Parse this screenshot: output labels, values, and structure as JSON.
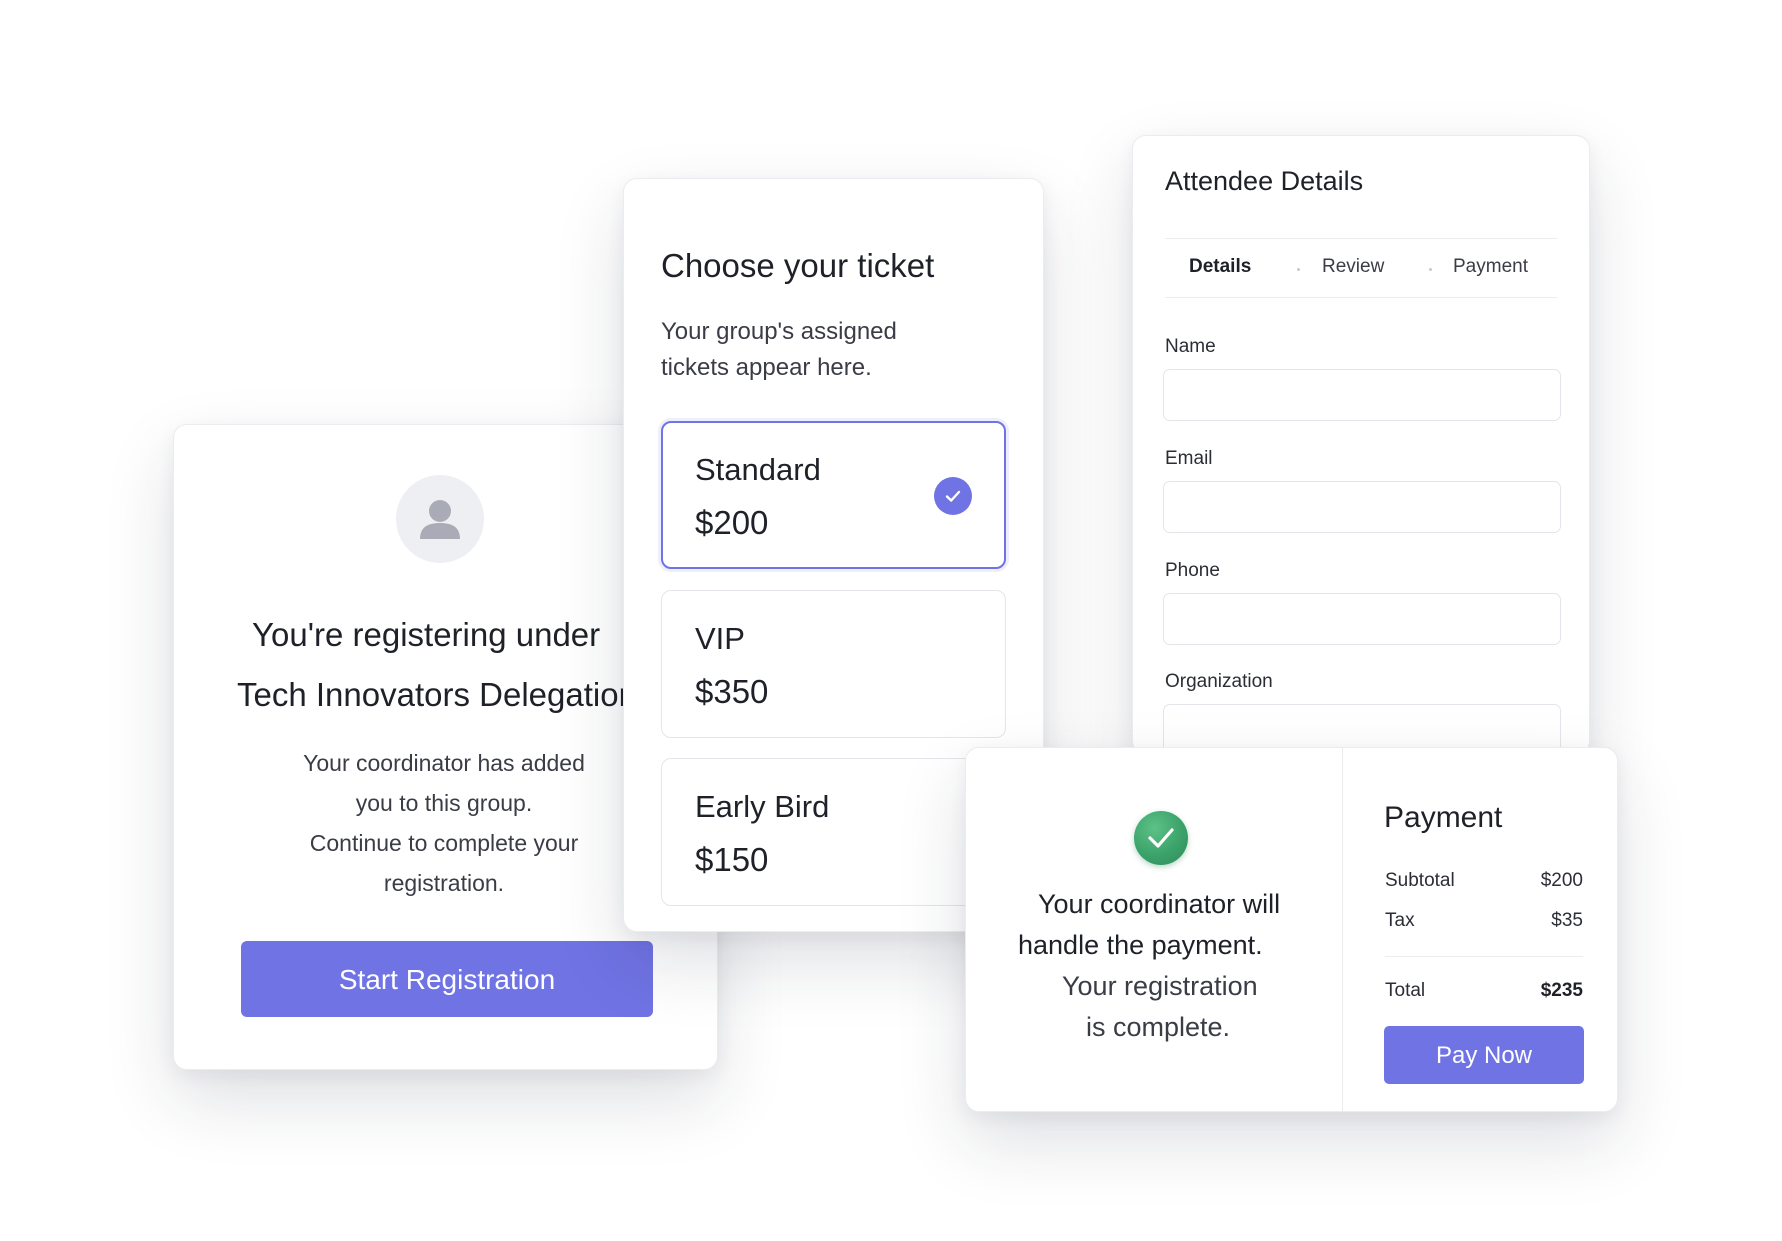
{
  "group_card": {
    "heading_line1": "You're registering under",
    "heading_line2": "Tech Innovators Delegation",
    "body_lines": [
      "Your coordinator has added",
      "you to this group.",
      "Continue to complete your",
      "registration."
    ],
    "start_button": "Start Registration",
    "icons": {
      "avatar": "user-avatar-icon"
    }
  },
  "ticket_card": {
    "title": "Choose your ticket",
    "subtitle_lines": [
      "Your group's assigned",
      "tickets appear here."
    ],
    "tickets": [
      {
        "name": "Standard",
        "price": "$200",
        "selected": true
      },
      {
        "name": "VIP",
        "price": "$350",
        "selected": false
      },
      {
        "name": "Early Bird",
        "price": "$150",
        "selected": false
      }
    ],
    "icons": {
      "selected": "check-circle-icon"
    }
  },
  "attendee_card": {
    "title": "Attendee Details",
    "tabs": [
      {
        "label": "Details",
        "active": true
      },
      {
        "label": "Review",
        "active": false
      },
      {
        "label": "Payment",
        "active": false
      }
    ],
    "fields": [
      {
        "label": "Name",
        "value": "",
        "placeholder": ""
      },
      {
        "label": "Email",
        "value": "",
        "placeholder": ""
      },
      {
        "label": "Phone",
        "value": "",
        "placeholder": ""
      },
      {
        "label": "Organization",
        "value": "",
        "placeholder": ""
      }
    ]
  },
  "payment_card": {
    "completion_lines": [
      "Your coordinator will",
      "handle the payment.",
      "Your registration",
      "is complete."
    ],
    "title": "Payment",
    "rows": [
      {
        "label": "Subtotal",
        "value": "$200"
      },
      {
        "label": "Tax",
        "value": "$35"
      }
    ],
    "total": {
      "label": "Total",
      "value": "$235"
    },
    "pay_button": "Pay Now",
    "icons": {
      "complete": "success-check-icon"
    }
  },
  "colors": {
    "accent": "#7073e4",
    "success": "#3ba26a",
    "text": "#1f2128",
    "border": "#e4e5ea"
  }
}
